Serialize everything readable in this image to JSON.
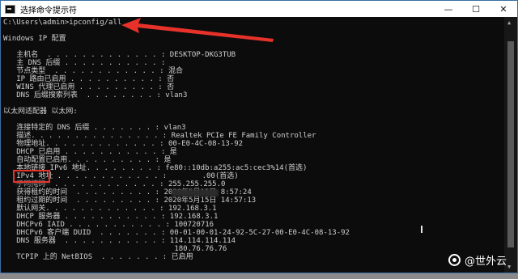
{
  "window": {
    "title": "选择命令提示符",
    "minimize_glyph": "—",
    "maximize_glyph": "☐",
    "close_glyph": "✕"
  },
  "console": {
    "lines": [
      "C:\\Users\\admin>ipconfig/all",
      "",
      "Windows IP 配置",
      "",
      "   主机名  . . . . . . . . . . . . . : DESKTOP-DKG3TUB",
      "   主 DNS 后缀 . . . . . . . . . . . :",
      "   节点类型  . . . . . . . . . . . . : 混合",
      "   IP 路由已启用 . . . . . . . . . . : 否",
      "   WINS 代理已启用 . . . . . . . . . : 否",
      "   DNS 后缀搜索列表  . . . . . . . . : vlan3",
      "",
      "以太网适配器 以太网:",
      "",
      "   连接特定的 DNS 后缀 . . . . . . . : vlan3",
      "   描述. . . . . . . . . . . . . . . : Realtek PCIe FE Family Controller",
      "   物理地址. . . . . . . . . . . . . : 00-E0-4C-08-13-92",
      "   DHCP 已启用 . . . . . . . . . . . : 是",
      "   自动配置已启用. . . . . . . . . . : 是",
      "   本地链接 IPv6 地址. . . . . . . . : fe80::10db:a255:ac5:cec3%14(首选)",
      "   IPv4 地址 . . . . . . . . . . . . :        .00(首选)",
      "   子网掩码  . . . . . . . . . . . . : 255.255.255.0",
      "   获得租约的时间  . . . . . . . . . : 2020年5月15日 8:57:24",
      "   租约过期的时间  . . . . . . . . . : 2020年5月15日 14:57:13",
      "   默认网关. . . . . . . . . . . . . : 192.168.3.1",
      "   DHCP 服务器 . . . . . . . . . . . : 192.168.3.1",
      "   DHCPv6 IAID . . . . . . . . . . . : 100720716",
      "   DHCPv6 客户端 DUID  . . . . . . . : 00-01-00-01-24-92-5C-27-00-E0-4C-08-13-92",
      "   DNS 服务器  . . . . . . . . . . . : 114.114.114.114",
      "                                       180.76.76.76",
      "   TCPIP 上的 NetBIOS  . . . . . . . : 已启用"
    ]
  },
  "watermark": {
    "text": "@世外云"
  },
  "colors": {
    "annotation": "#e6322a",
    "console_bg": "#0c0c0c",
    "console_text": "#d0d0d0"
  },
  "icons": {
    "app": "cmd-icon",
    "annotation": "red-arrow-icon"
  }
}
